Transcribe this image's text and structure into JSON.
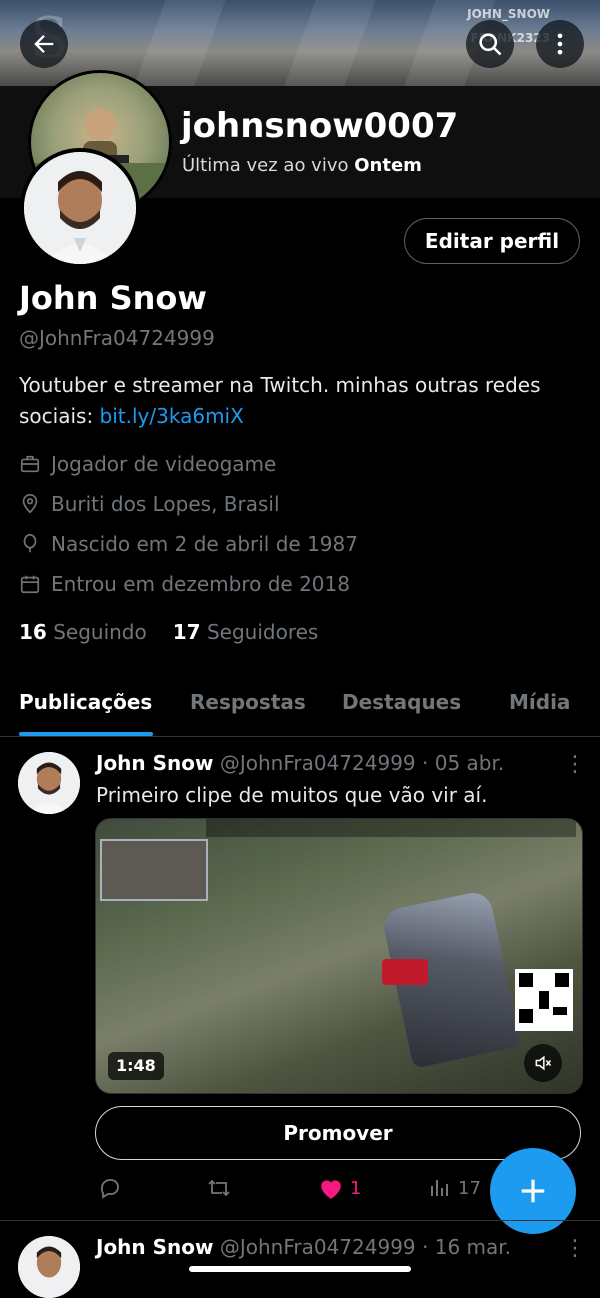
{
  "banner": {
    "watermark_channel": "JOHN_SNOW",
    "watermark_handle": "FRANK2323"
  },
  "header": {
    "username": "johnsnow0007",
    "last_seen_prefix": "Última vez ao vivo",
    "last_seen_value": "Ontem",
    "edit_profile_label": "Editar perfil"
  },
  "profile": {
    "display_name": "John Snow",
    "handle": "@JohnFra04724999",
    "bio_text": "Youtuber e streamer na Twitch. minhas outras redes sociais:",
    "bio_link": "bit.ly/3ka6miX",
    "category": "Jogador de videogame",
    "location": "Buriti dos Lopes, Brasil",
    "birth": "Nascido em 2 de abril de 1987",
    "joined": "Entrou em dezembro de 2018",
    "following_count": "16",
    "following_label": "Seguindo",
    "followers_count": "17",
    "followers_label": "Seguidores"
  },
  "tabs": [
    {
      "label": "Publicações",
      "active": true
    },
    {
      "label": "Respostas",
      "active": false
    },
    {
      "label": "Destaques",
      "active": false
    },
    {
      "label": "Mídia",
      "active": false
    }
  ],
  "posts": [
    {
      "name": "John Snow",
      "handle": "@JohnFra04724999",
      "date": "· 05 abr.",
      "text": "Primeiro clipe de muitos que vão vir aí.",
      "video_duration": "1:48",
      "promote_label": "Promover",
      "likes": "1",
      "views": "17"
    },
    {
      "name": "John Snow",
      "handle": "@JohnFra04724999",
      "date": "· 16 mar."
    }
  ],
  "colors": {
    "accent": "#1d9bf0",
    "like": "#f91880",
    "muted": "#71767b"
  }
}
